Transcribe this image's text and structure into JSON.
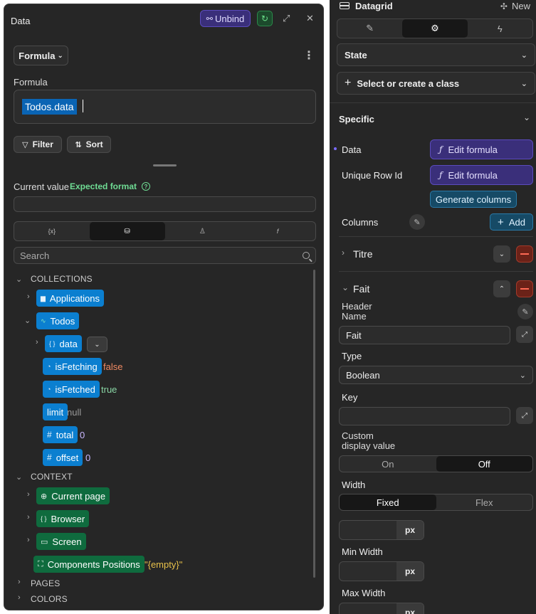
{
  "sidebar": {
    "title": "Datagrid",
    "new_label": "New",
    "state_label": "State",
    "class_label": "Select or create a class",
    "specific_label": "Specific",
    "data_label": "Data",
    "data_formula_label": "Edit formula",
    "unique_row_label": "Unique Row Id",
    "unique_formula_label": "Edit formula",
    "generate_label": "Generate columns",
    "columns_label": "Columns",
    "add_label": "Add",
    "col_titre": "Titre",
    "col_fait": "Fait",
    "header_name_label": "Header\nName",
    "header_name_value": "Fait",
    "type_label": "Type",
    "type_value": "Boolean",
    "key_label": "Key",
    "custom_display_label": "Custom\ndisplay value",
    "on_label": "On",
    "off_label": "Off",
    "width_label": "Width",
    "fixed_label": "Fixed",
    "flex_label": "Flex",
    "px_unit": "px",
    "min_width_label": "Min Width",
    "max_width_label": "Max Width"
  },
  "panel": {
    "title": "Data",
    "unbind_label": "Unbind",
    "mode_label": "Formula",
    "formula_label": "Formula",
    "formula_value": "Todos.data",
    "filter_label": "Filter",
    "sort_label": "Sort",
    "current_value_label": "Current value",
    "expected_format_label": "Expected format",
    "tabs": [
      "{x}",
      "db",
      "user",
      "f"
    ],
    "search_placeholder": "Search",
    "collections_label": "COLLECTIONS",
    "context_label": "CONTEXT",
    "pages_label": "PAGES",
    "colors_label": "COLORS",
    "items": {
      "applications": "Applications",
      "todos": "Todos",
      "data": "data",
      "is_fetching": "isFetching",
      "is_fetching_value": "false",
      "is_fetched": "isFetched",
      "is_fetched_value": "true",
      "limit": "limit",
      "limit_value": "null",
      "total": "total",
      "total_value": "0",
      "offset": "offset",
      "offset_value": "0",
      "current_page": "Current page",
      "browser": "Browser",
      "screen": "Screen",
      "components_positions": "Components Positions",
      "components_positions_value": "\"{empty}\""
    }
  }
}
